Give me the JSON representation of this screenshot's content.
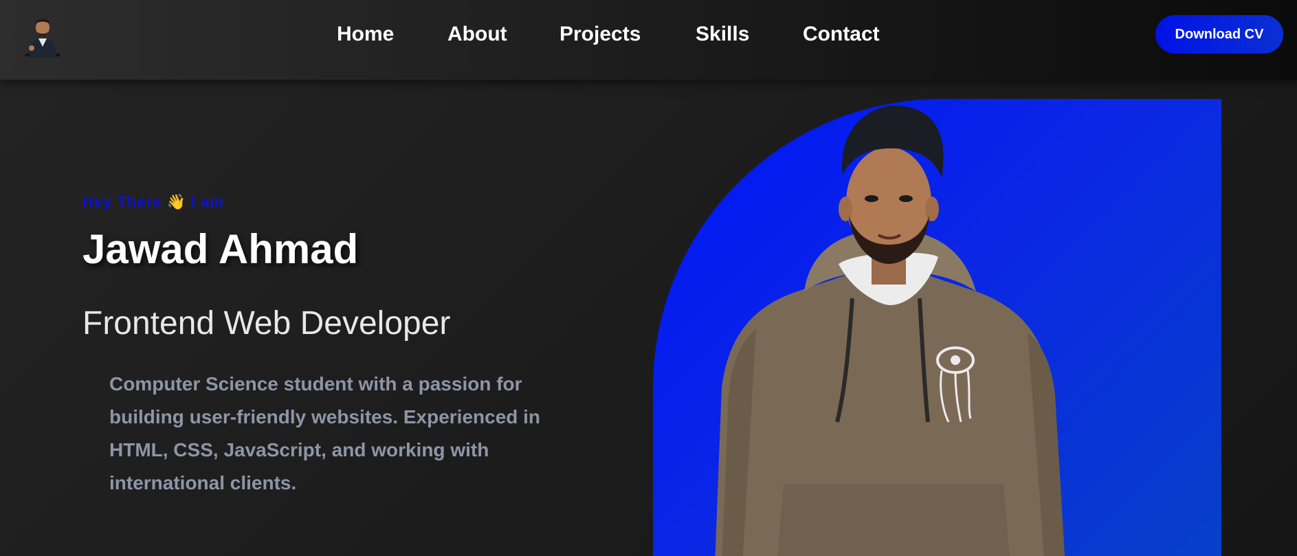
{
  "nav": {
    "links": [
      {
        "label": "Home"
      },
      {
        "label": "About"
      },
      {
        "label": "Projects"
      },
      {
        "label": "Skills"
      },
      {
        "label": "Contact"
      }
    ],
    "cta_label": "Download CV"
  },
  "hero": {
    "greeting": "Hey There 👋 I am",
    "name": "Jawad Ahmad",
    "role": "Frontend Web Developer",
    "description": "Computer Science student with a passion for building user-friendly websites. Experienced in HTML, CSS, JavaScript, and working with international clients."
  },
  "colors": {
    "accent": "#0012e6",
    "greeting": "#0a12d8",
    "description": "#8e95a8",
    "background": "#1b1b1b"
  },
  "icons": {
    "logo": "avatar-logo",
    "portrait": "portrait-photo"
  }
}
